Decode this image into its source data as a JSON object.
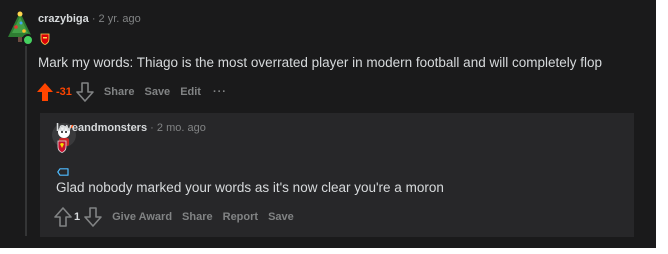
{
  "comment": {
    "username": "crazybiga",
    "separator": "·",
    "time": "2 yr. ago",
    "flair_icon": "arsenal-crest-icon",
    "body": "Mark my words: Thiago is the most overrated player in modern football and will completely flop",
    "score": "-31",
    "actions": {
      "share": "Share",
      "save": "Save",
      "edit": "Edit",
      "more": "···"
    }
  },
  "reply": {
    "username": "loveandmonsters",
    "separator": "·",
    "time": "2 mo. ago",
    "flair_icon": "liverpool-crest-icon",
    "body": "Glad nobody marked your words as it's now clear you're a moron",
    "score": "1",
    "actions": {
      "award": "Give Award",
      "share": "Share",
      "report": "Report",
      "save": "Save"
    }
  },
  "colors": {
    "background": "#1a1a1b",
    "reply_background": "#272729",
    "text": "#d7dadc",
    "muted": "#818384",
    "downvote": "#ff4500",
    "online": "#46d160"
  }
}
